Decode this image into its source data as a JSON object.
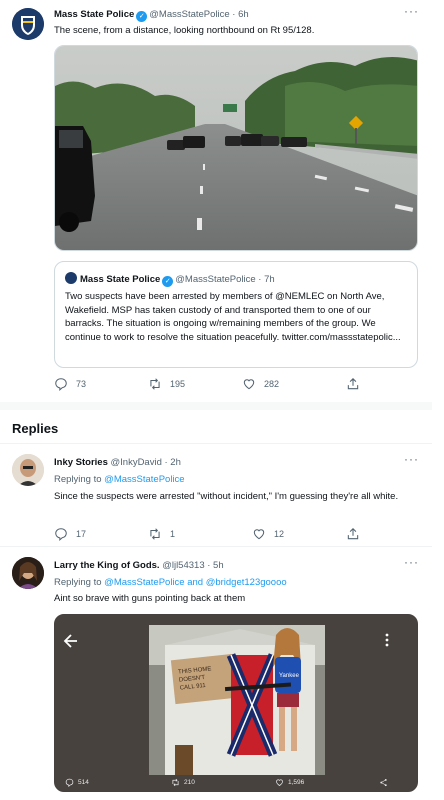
{
  "main_tweet": {
    "author_name": "Mass State Police",
    "handle_time": "@MassStatePolice · 6h",
    "text": "The scene, from a distance, looking northbound on Rt 95/128.",
    "quote": {
      "author_name": "Mass State Police",
      "handle_time": "@MassStatePolice · 7h",
      "text": "Two suspects have been arrested by members of @NEMLEC on North Ave, Wakefield. MSP has taken custody of and transported them to one of our barracks. The situation is ongoing w/remaining members of the group. We continue to work to resolve the situation peacefully. twitter.com/massstatepolic..."
    },
    "replies_count": "73",
    "retweets_count": "195",
    "likes_count": "282"
  },
  "replies_heading": "Replies",
  "replies": [
    {
      "author_name": "Inky Stories",
      "handle_time": "@InkyDavid · 2h",
      "replying_prefix": "Replying to",
      "replying_to": "@MassStatePolice",
      "text": "Since the suspects were arrested \"without incident,\" I'm guessing they're all white.",
      "replies_count": "17",
      "retweets_count": "1",
      "likes_count": "12"
    },
    {
      "author_name": "Larry the King of Gods.",
      "handle_time": "@ljl54313 · 5h",
      "replying_prefix": "Replying to",
      "replying_to": "@MassStatePolice and @bridget123goooo",
      "text": "Aint so brave with guns pointing back at them",
      "media": {
        "sign_text": "THIS HOME DOESN'T CALL 911",
        "shirt_text": "Yankee",
        "replies_count": "514",
        "retweets_count": "210",
        "likes_count": "1,596"
      }
    }
  ],
  "icons": [
    "verified-badge-icon",
    "reply-icon",
    "retweet-icon",
    "like-icon",
    "share-icon",
    "more-icon",
    "back-arrow-icon"
  ],
  "colors": {
    "accent": "#1d9bf0",
    "muted": "#536471",
    "border": "#cfd9de"
  }
}
